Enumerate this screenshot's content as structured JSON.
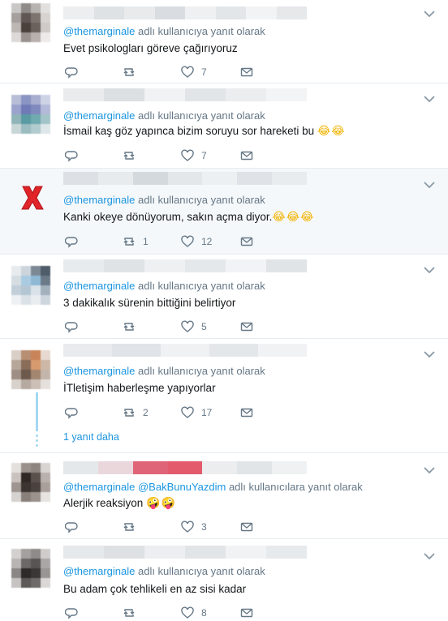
{
  "labels": {
    "reply_suffix": "adlı kullanıcıya yanıt olarak",
    "reply_suffix_plural": "adlı kullanıcılara yanıt olarak",
    "show_more_replies": "1 yanıt daha"
  },
  "icons": {
    "reply": "reply-icon",
    "retweet": "retweet-icon",
    "like": "heart-icon",
    "message": "envelope-icon",
    "menu": "chevron-down-icon"
  },
  "colors": {
    "mention": "#1b95e0",
    "secondary_text": "#657786",
    "highlight_background": "#f5f8fa",
    "thread_line": "#a4d9f3"
  },
  "tweets": [
    {
      "mention_1": "@themarginale",
      "text": "Evet psikologları göreve çağırıyoruz",
      "emoji": "",
      "retweets": "",
      "likes": "7"
    },
    {
      "mention_1": "@themarginale",
      "text": "İsmail kaş göz yapınca bizim soruyu sor hareketi bu ",
      "emoji": "😂😂",
      "retweets": "",
      "likes": "7"
    },
    {
      "mention_1": "@themarginale",
      "text": "Kanki okeye dönüyorum, sakın açma diyor.",
      "emoji": "😂😂😂",
      "retweets": "1",
      "likes": "12"
    },
    {
      "mention_1": "@themarginale",
      "text": "3 dakikalık sürenin bittiğini belirtiyor",
      "emoji": "",
      "retweets": "",
      "likes": "5"
    },
    {
      "mention_1": "@themarginale",
      "text": "İTletişim haberleşme yapıyorlar",
      "emoji": "",
      "retweets": "2",
      "likes": "17"
    },
    {
      "mention_1": "@themarginale",
      "mention_2": "@BakBunuYazdim",
      "text": "Alerjik reaksiyon ",
      "emoji": "🤪🤪",
      "retweets": "",
      "likes": "3"
    },
    {
      "mention_1": "@themarginale",
      "text": "Bu adam çok tehlikeli en az sisi kadar",
      "emoji": "",
      "retweets": "",
      "likes": "8"
    }
  ]
}
